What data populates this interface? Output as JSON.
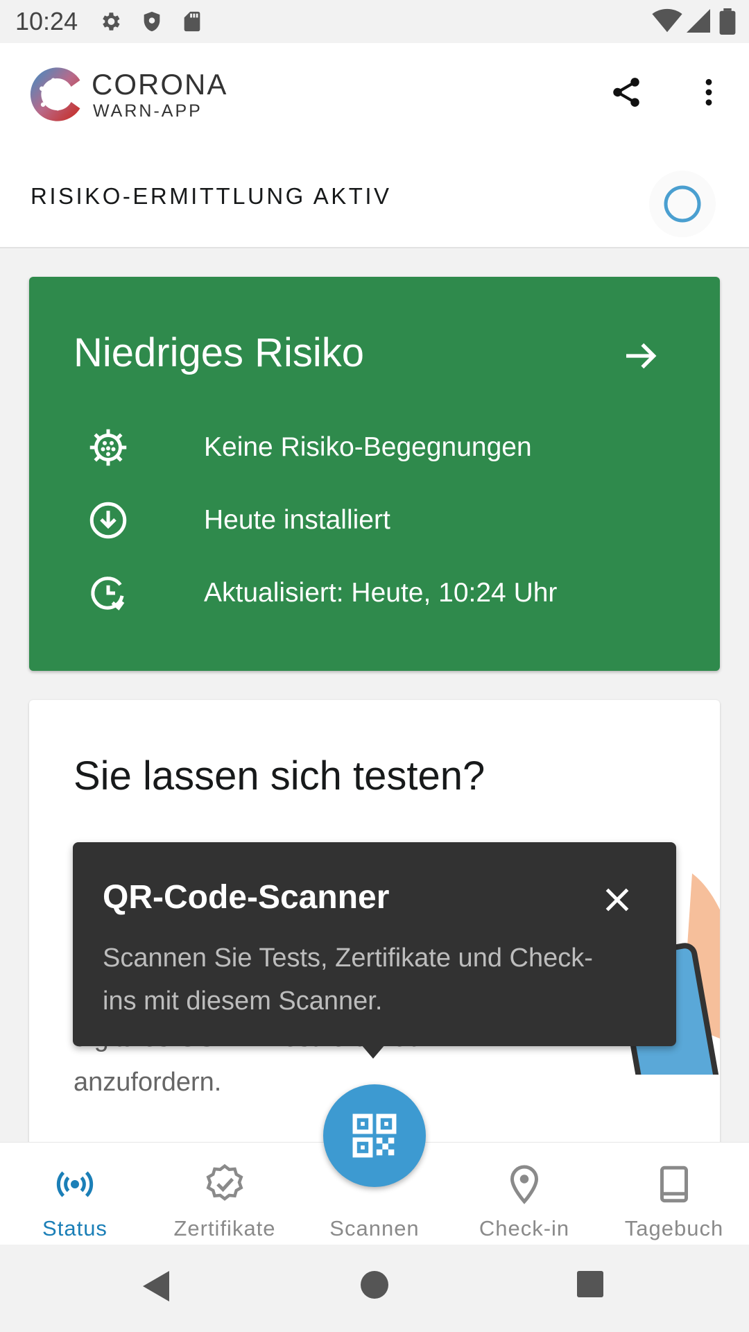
{
  "status_bar": {
    "time": "10:24",
    "icons_left": [
      "settings-icon",
      "shield-icon",
      "sd-card-icon"
    ],
    "icons_right": [
      "wifi-icon",
      "signal-icon",
      "battery-icon"
    ]
  },
  "header": {
    "logo_line1": "CORONA",
    "logo_line2": "WARN-APP",
    "risk_tracing_label": "RISIKO-ERMITTLUNG AKTIV"
  },
  "risk_card": {
    "title": "Niedriges Risiko",
    "color": "#2f8a4c",
    "rows": [
      {
        "icon": "virus-icon",
        "text": "Keine Risiko-Begegnungen"
      },
      {
        "icon": "download-icon",
        "text": "Heute installiert"
      },
      {
        "icon": "clock-refresh-icon",
        "text": "Aktualisiert: Heute, 10:24 Uhr"
      }
    ]
  },
  "test_card": {
    "title": "Sie lassen sich testen?",
    "body_line1": "digitales COVID-Testzertifikat",
    "body_line2": "anzufordern."
  },
  "tooltip": {
    "title": "QR-Code-Scanner",
    "body": "Scannen Sie Tests, Zertifikate und Check-ins mit diesem Scanner."
  },
  "bottom_nav": {
    "accent_color": "#1b7fb7",
    "items": [
      {
        "label": "Status",
        "icon": "broadcast-icon",
        "active": true
      },
      {
        "label": "Zertifikate",
        "icon": "certificate-badge-icon",
        "active": false
      },
      {
        "label": "Scannen",
        "icon": "qr-code-icon",
        "active": false
      },
      {
        "label": "Check-in",
        "icon": "location-pin-icon",
        "active": false
      },
      {
        "label": "Tagebuch",
        "icon": "book-icon",
        "active": false
      }
    ]
  }
}
